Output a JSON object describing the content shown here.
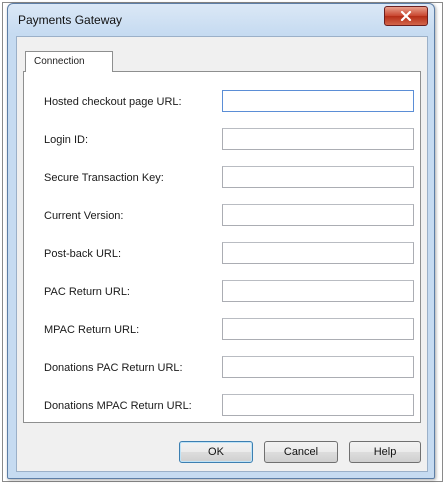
{
  "window": {
    "title": "Payments Gateway",
    "close_icon": "close-x-icon"
  },
  "tabs": [
    {
      "label": "Connection",
      "selected": true
    }
  ],
  "fields": [
    {
      "label": "Hosted checkout page URL:",
      "value": ""
    },
    {
      "label": "Login ID:",
      "value": ""
    },
    {
      "label": "Secure Transaction Key:",
      "value": ""
    },
    {
      "label": "Current Version:",
      "value": ""
    },
    {
      "label": "Post-back URL:",
      "value": ""
    },
    {
      "label": "PAC Return URL:",
      "value": ""
    },
    {
      "label": "MPAC Return URL:",
      "value": ""
    },
    {
      "label": "Donations PAC Return URL:",
      "value": ""
    },
    {
      "label": "Donations MPAC Return URL:",
      "value": ""
    }
  ],
  "buttons": {
    "ok": "OK",
    "cancel": "Cancel",
    "help": "Help"
  },
  "colors": {
    "close_button": "#c8452f",
    "title_bar": "#c6dbf1",
    "focus_border": "#5b8ed6"
  }
}
